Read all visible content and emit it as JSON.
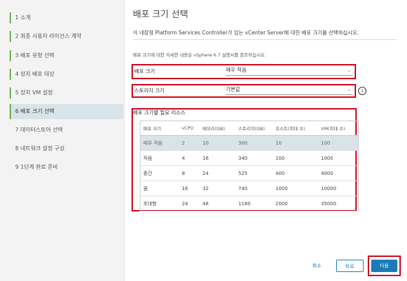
{
  "sidebar": {
    "steps": [
      {
        "label": "1  소개"
      },
      {
        "label": "2  최종 사용자 라이선스 계약"
      },
      {
        "label": "3  배포 유형 선택"
      },
      {
        "label": "4  장치 배포 대상"
      },
      {
        "label": "5  장치 VM 설정"
      },
      {
        "label": "6  배포 크기 선택"
      },
      {
        "label": "7  데이터스토어 선택"
      },
      {
        "label": "8  네트워크 설정 구성"
      },
      {
        "label": "9  1단계 완료 준비"
      }
    ],
    "active_index": 5
  },
  "main": {
    "title": "배포 크기 선택",
    "description": "이 내장형 Platform Services Controller가 있는 vCenter Server에 대한 배포 크기를 선택하십시오.",
    "note": "배포 크기에 대한 자세한 내용은 vSphere 6.7 설명서를 참조하십시오.",
    "deploy_size": {
      "label": "배포 크기",
      "value": "매우 작음"
    },
    "storage_size": {
      "label": "스토리지 크기",
      "value": "기본값"
    },
    "resources_title": "배포 크기별 필요 리소스",
    "table": {
      "headers": [
        "배포 크기",
        "vCPU",
        "메모리(GB)",
        "스토리지(GB)",
        "호스트(최대 수)",
        "VM(최대 수)"
      ],
      "rows": [
        [
          "매우 작음",
          "2",
          "10",
          "300",
          "10",
          "100"
        ],
        [
          "작음",
          "4",
          "16",
          "340",
          "100",
          "1000"
        ],
        [
          "중간",
          "8",
          "24",
          "525",
          "400",
          "4000"
        ],
        [
          "큼",
          "16",
          "32",
          "740",
          "1000",
          "10000"
        ],
        [
          "초대형",
          "24",
          "48",
          "1180",
          "2000",
          "35000"
        ]
      ],
      "selected_row": 0
    }
  },
  "footer": {
    "cancel_label": "취소",
    "back_label": "뒤로",
    "next_label": "다음"
  },
  "colors": {
    "accent": "#1a7bb8",
    "highlight": "#d0021b",
    "step_done": "#6ab04c",
    "selection": "#d9e3ea"
  },
  "icons": {
    "info": "info-circle-icon",
    "dropdown": "chevron-down-icon"
  }
}
